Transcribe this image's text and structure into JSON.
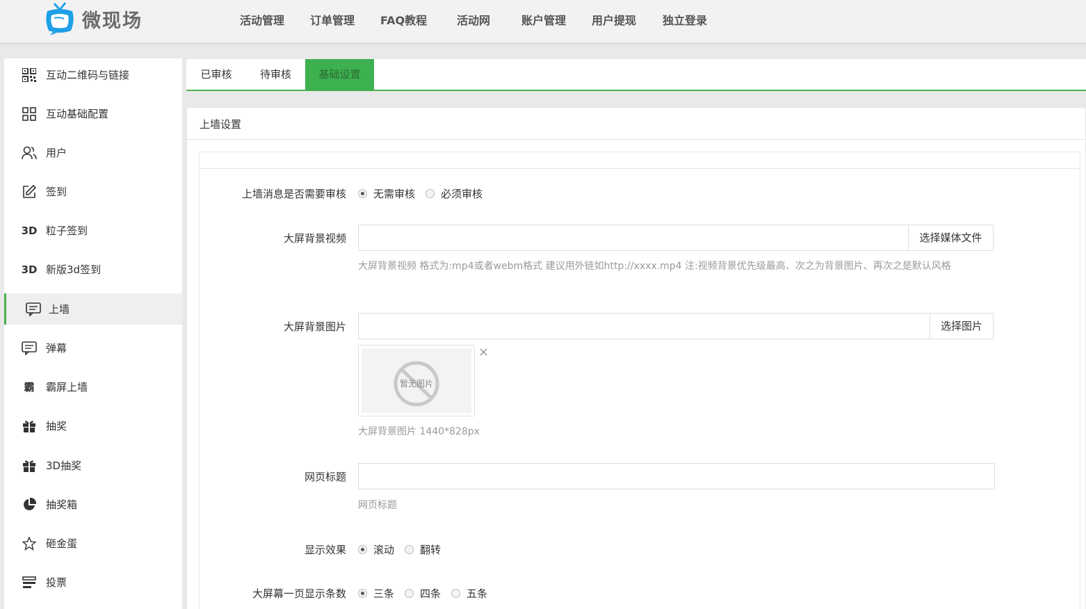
{
  "brand": {
    "name": "微现场"
  },
  "nav": [
    "活动管理",
    "订单管理",
    "FAQ教程",
    "活动网",
    "账户管理",
    "用户提现",
    "独立登录"
  ],
  "sidebar": {
    "items": [
      {
        "label": "互动二维码与链接",
        "icon": "qr-code-icon"
      },
      {
        "label": "互动基础配置",
        "icon": "grid-icon"
      },
      {
        "label": "用户",
        "icon": "users-icon"
      },
      {
        "label": "签到",
        "icon": "edit-icon"
      },
      {
        "label": "粒子签到",
        "icon": "3d-icon",
        "glyph": "3D"
      },
      {
        "label": "新版3d签到",
        "icon": "3d-icon",
        "glyph": "3D"
      },
      {
        "label": "上墙",
        "icon": "message-icon",
        "active": true
      },
      {
        "label": "弹幕",
        "icon": "message-icon"
      },
      {
        "label": "霸屏上墙",
        "icon": "ba-icon",
        "glyph": "霸"
      },
      {
        "label": "抽奖",
        "icon": "gift-icon"
      },
      {
        "label": "3D抽奖",
        "icon": "gift-icon"
      },
      {
        "label": "抽奖箱",
        "icon": "pie-chart-icon"
      },
      {
        "label": "砸金蛋",
        "icon": "star-icon"
      },
      {
        "label": "投票",
        "icon": "list-icon"
      }
    ]
  },
  "tabs": [
    "已审核",
    "待审核",
    "基础设置"
  ],
  "panel": {
    "title": "上墙设置",
    "fields": {
      "audit": {
        "label": "上墙消息是否需要审核",
        "options": [
          "无需审核",
          "必须审核"
        ],
        "selected": 0
      },
      "bg_video": {
        "label": "大屏背景视频",
        "value": "",
        "button": "选择媒体文件",
        "help": "大屏背景视频 格式为:mp4或者webm格式 建议用外链如http://xxxx.mp4 注:视频背景优先级最高、次之为背景图片、再次之是默认风格"
      },
      "bg_image": {
        "label": "大屏背景图片",
        "value": "",
        "button": "选择图片",
        "placeholder_text": "暂无图片",
        "close": "×",
        "help": "大屏背景图片 1440*828px"
      },
      "page_title": {
        "label": "网页标题",
        "value": "",
        "help": "网页标题"
      },
      "effect": {
        "label": "显示效果",
        "options": [
          "滚动",
          "翻转"
        ],
        "selected": 0
      },
      "per_page": {
        "label": "大屏幕一页显示条数",
        "options": [
          "三条",
          "四条",
          "五条"
        ],
        "selected": 0
      }
    }
  },
  "colors": {
    "accent": "#3db14f",
    "accent_text": "#2a6b33",
    "logo_blue": "#1ea0e6",
    "help_text": "#9a9a9a"
  }
}
